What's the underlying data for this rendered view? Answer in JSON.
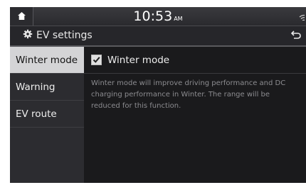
{
  "status": {
    "time": "10:53",
    "ampm": "AM"
  },
  "header": {
    "title": "EV settings"
  },
  "sidebar": {
    "items": [
      {
        "label": "Winter mode",
        "active": true
      },
      {
        "label": "Warning",
        "active": false
      },
      {
        "label": "EV route",
        "active": false
      }
    ]
  },
  "content": {
    "option_label": "Winter mode",
    "option_checked": true,
    "description": "Winter mode will improve driving performance and DC charging performance in Winter. The range will be reduced for this function."
  },
  "colors": {
    "active_tab": "#d4d4d6",
    "background": "#161618",
    "description_text": "#8c8c90"
  }
}
